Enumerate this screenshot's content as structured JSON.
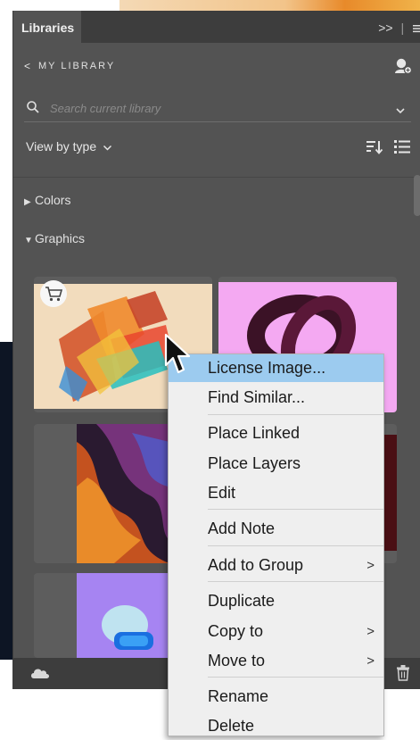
{
  "panel": {
    "tab_label": "Libraries",
    "tab_controls": ">>",
    "back_label": "<",
    "library_name": "MY LIBRARY",
    "search_placeholder": "Search current library",
    "view_by_label": "View by type"
  },
  "sections": {
    "colors": "Colors",
    "graphics": "Graphics"
  },
  "icons": {
    "back": "chevron-left-icon",
    "user": "user-add-icon",
    "search": "search-icon",
    "dropdown": "chevron-down-icon",
    "sort": "sort-icon",
    "list": "list-view-icon",
    "cart": "cart-icon",
    "cloud": "cloud-icon",
    "trash": "trash-icon",
    "cursor": "mouse-cursor-icon"
  },
  "context_menu": {
    "items": [
      {
        "label": "License Image...",
        "highlighted": true
      },
      {
        "label": "Find Similar..."
      },
      {
        "label": "Place Linked"
      },
      {
        "label": "Place Layers"
      },
      {
        "label": "Edit"
      },
      {
        "label": "Add Note"
      },
      {
        "label": "Add to Group",
        "submenu": true
      },
      {
        "label": "Duplicate"
      },
      {
        "label": "Copy to",
        "submenu": true
      },
      {
        "label": "Move to",
        "submenu": true
      },
      {
        "label": "Rename"
      },
      {
        "label": "Delete"
      }
    ],
    "submenu_arrow": ">"
  },
  "colors": {
    "panel_bg": "#535353",
    "tabbar_bg": "#3d3d3d",
    "menu_bg": "#efefef",
    "menu_highlight": "#9ccbef"
  }
}
